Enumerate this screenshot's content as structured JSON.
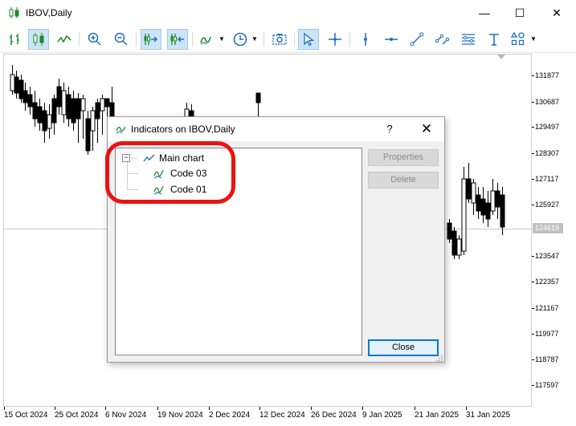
{
  "window": {
    "title": "IBOV,Daily",
    "controls": {
      "minimize": "—",
      "maximize": "☐",
      "close": "✕"
    }
  },
  "toolbar": {
    "items": [
      {
        "name": "bar-chart-icon",
        "active": false
      },
      {
        "name": "candlestick-chart-icon",
        "active": true
      },
      {
        "name": "line-chart-icon",
        "active": false
      },
      {
        "name": "zoom-in-icon",
        "active": false
      },
      {
        "name": "zoom-out-icon",
        "active": false
      },
      {
        "name": "auto-scroll-icon",
        "active": true
      },
      {
        "name": "chart-shift-icon",
        "active": true
      },
      {
        "name": "indicators-icon",
        "active": false
      },
      {
        "name": "periods-clock-icon",
        "active": false
      },
      {
        "name": "screenshot-camera-icon",
        "active": false
      },
      {
        "name": "cursor-arrow-icon",
        "active": true
      },
      {
        "name": "crosshair-icon",
        "active": false
      },
      {
        "name": "vertical-line-icon",
        "active": false
      },
      {
        "name": "horizontal-line-icon",
        "active": false
      },
      {
        "name": "trendline-icon",
        "active": false
      },
      {
        "name": "equidistant-channel-icon",
        "active": false
      },
      {
        "name": "fibonacci-icon",
        "active": false
      },
      {
        "name": "text-tool-icon",
        "active": false
      },
      {
        "name": "shapes-icon",
        "active": false
      }
    ]
  },
  "chart": {
    "price_labels": [
      "131877",
      "130687",
      "129497",
      "128307",
      "127117",
      "125927",
      "124619",
      "123547",
      "122357",
      "121167",
      "119977",
      "118787",
      "117597"
    ],
    "current_price": "124619",
    "date_labels": [
      "15 Oct 2024",
      "25 Oct 2024",
      "6 Nov 2024",
      "19 Nov 2024",
      "2 Dec 2024",
      "12 Dec 2024",
      "26 Dec 2024",
      "9 Jan 2025",
      "21 Jan 2025",
      "31 Jan 2025"
    ],
    "colors": {
      "bull": "#ffffff",
      "bear": "#000000",
      "grid": "#c8c8c8"
    }
  },
  "dialog": {
    "title": "Indicators on IBOV,Daily",
    "help": "?",
    "close_glyph": "✕",
    "tree": {
      "root": {
        "label": "Main chart",
        "expander": "−"
      },
      "children": [
        {
          "label": "Code 03"
        },
        {
          "label": "Code 01"
        }
      ]
    },
    "buttons": {
      "properties": "Properties",
      "delete": "Delete",
      "close": "Close"
    }
  },
  "annotation": {
    "highlight_color": "#ee1111"
  }
}
